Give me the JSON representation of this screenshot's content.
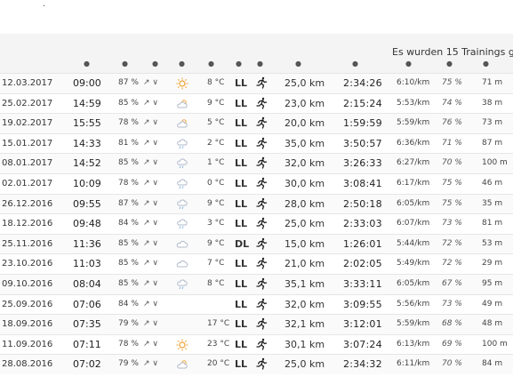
{
  "top": {
    "dot": "."
  },
  "summary_text": "Es wurden 15 Trainings ge",
  "header_markers": [
    "●",
    "●",
    "●",
    "●",
    "●",
    "●",
    "●",
    "●",
    "●",
    "●",
    "●",
    "●"
  ],
  "colors": {
    "sun": "#f0a030",
    "cloud": "#b0b8c8",
    "rain": "#8ab4e0",
    "runner": "#222222"
  },
  "rows": [
    {
      "date": "12.03.2017",
      "time": "09:00",
      "humidity": "87 %",
      "wind": "↗ ∨",
      "weather": "sun",
      "temp": "8 °C",
      "ground": "LL",
      "distance": "25,0 km",
      "duration": "2:34:26",
      "pace": "6:10/km",
      "effort": "75 %",
      "elevation": "71 m"
    },
    {
      "date": "25.02.2017",
      "time": "14:59",
      "humidity": "85 %",
      "wind": "↗ ∨",
      "weather": "cloud",
      "temp": "9 °C",
      "ground": "LL",
      "distance": "23,0 km",
      "duration": "2:15:24",
      "pace": "5:53/km",
      "effort": "74 %",
      "elevation": "38 m"
    },
    {
      "date": "19.02.2017",
      "time": "15:55",
      "humidity": "78 %",
      "wind": "↗ ∨",
      "weather": "cloud",
      "temp": "5 °C",
      "ground": "LL",
      "distance": "20,0 km",
      "duration": "1:59:59",
      "pace": "5:59/km",
      "effort": "76 %",
      "elevation": "73 m"
    },
    {
      "date": "15.01.2017",
      "time": "14:33",
      "humidity": "81 %",
      "wind": "↗ ∨",
      "weather": "rain",
      "temp": "2 °C",
      "ground": "LL",
      "distance": "35,0 km",
      "duration": "3:50:57",
      "pace": "6:36/km",
      "effort": "71 %",
      "elevation": "87 m"
    },
    {
      "date": "08.01.2017",
      "time": "14:52",
      "humidity": "85 %",
      "wind": "↗ ∨",
      "weather": "rain",
      "temp": "1 °C",
      "ground": "LL",
      "distance": "32,0 km",
      "duration": "3:26:33",
      "pace": "6:27/km",
      "effort": "70 %",
      "elevation": "100 m"
    },
    {
      "date": "02.01.2017",
      "time": "10:09",
      "humidity": "78 %",
      "wind": "↗ ∨",
      "weather": "rain",
      "temp": "0 °C",
      "ground": "LL",
      "distance": "30,0 km",
      "duration": "3:08:41",
      "pace": "6:17/km",
      "effort": "75 %",
      "elevation": "46 m"
    },
    {
      "date": "26.12.2016",
      "time": "09:55",
      "humidity": "87 %",
      "wind": "↗ ∨",
      "weather": "rain",
      "temp": "9 °C",
      "ground": "LL",
      "distance": "28,0 km",
      "duration": "2:50:18",
      "pace": "6:05/km",
      "effort": "75 %",
      "elevation": "35 m"
    },
    {
      "date": "18.12.2016",
      "time": "09:48",
      "humidity": "84 %",
      "wind": "↗ ∨",
      "weather": "rain",
      "temp": "3 °C",
      "ground": "LL",
      "distance": "25,0 km",
      "duration": "2:33:03",
      "pace": "6:07/km",
      "effort": "73 %",
      "elevation": "81 m"
    },
    {
      "date": "25.11.2016",
      "time": "11:36",
      "humidity": "85 %",
      "wind": "↗ ∨",
      "weather": "cloud-plain",
      "temp": "9 °C",
      "ground": "DL",
      "distance": "15,0 km",
      "duration": "1:26:01",
      "pace": "5:44/km",
      "effort": "72 %",
      "elevation": "53 m"
    },
    {
      "date": "23.10.2016",
      "time": "11:03",
      "humidity": "85 %",
      "wind": "↗ ∨",
      "weather": "cloud-plain",
      "temp": "7 °C",
      "ground": "LL",
      "distance": "21,0 km",
      "duration": "2:02:05",
      "pace": "5:49/km",
      "effort": "72 %",
      "elevation": "29 m"
    },
    {
      "date": "09.10.2016",
      "time": "08:04",
      "humidity": "85 %",
      "wind": "↗ ∨",
      "weather": "rain",
      "temp": "8 °C",
      "ground": "LL",
      "distance": "35,1 km",
      "duration": "3:33:11",
      "pace": "6:05/km",
      "effort": "67 %",
      "elevation": "95 m"
    },
    {
      "date": "25.09.2016",
      "time": "07:06",
      "humidity": "84 %",
      "wind": "↗ ∨",
      "weather": "",
      "temp": "",
      "ground": "LL",
      "distance": "32,0 km",
      "duration": "3:09:55",
      "pace": "5:56/km",
      "effort": "73 %",
      "elevation": "49 m"
    },
    {
      "date": "18.09.2016",
      "time": "07:35",
      "humidity": "79 %",
      "wind": "↗ ∨",
      "weather": "",
      "temp": "17 °C",
      "ground": "LL",
      "distance": "32,1 km",
      "duration": "3:12:01",
      "pace": "5:59/km",
      "effort": "68 %",
      "elevation": "48 m"
    },
    {
      "date": "11.09.2016",
      "time": "07:11",
      "humidity": "78 %",
      "wind": "↗ ∨",
      "weather": "sun",
      "temp": "23 °C",
      "ground": "LL",
      "distance": "30,1 km",
      "duration": "3:07:24",
      "pace": "6:13/km",
      "effort": "69 %",
      "elevation": "100 m"
    },
    {
      "date": "28.08.2016",
      "time": "07:02",
      "humidity": "79 %",
      "wind": "↗ ∨",
      "weather": "cloud",
      "temp": "20 °C",
      "ground": "LL",
      "distance": "25,0 km",
      "duration": "2:34:32",
      "pace": "6:11/km",
      "effort": "70 %",
      "elevation": "84 m"
    }
  ]
}
